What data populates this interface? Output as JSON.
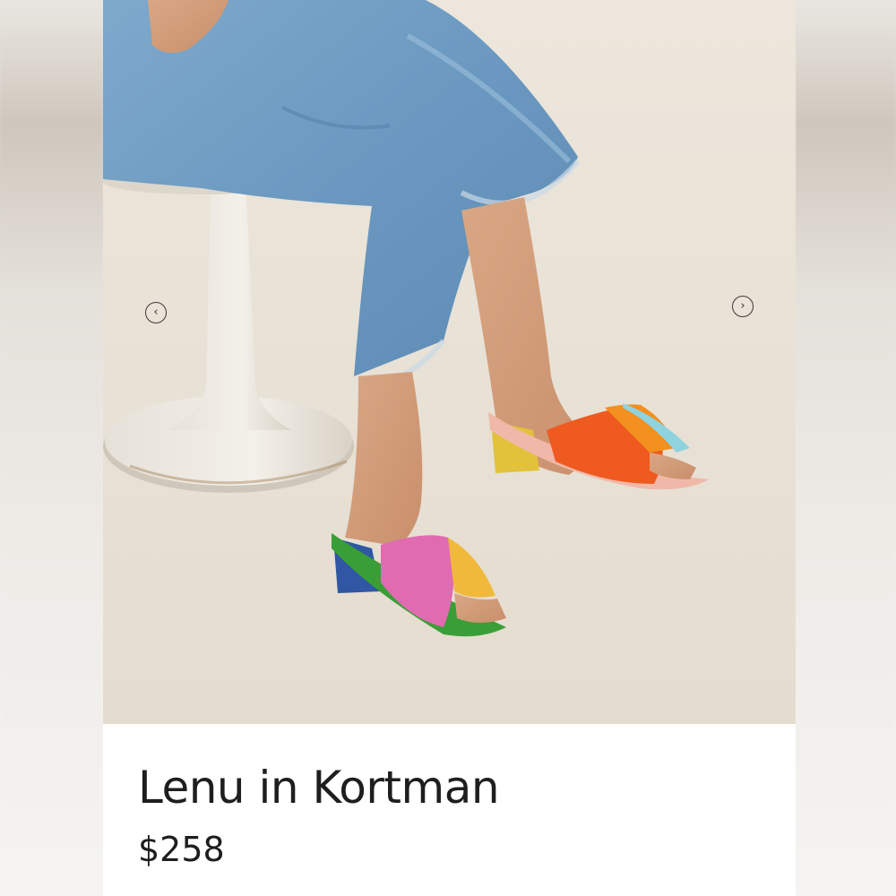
{
  "product": {
    "title": "Lenu in Kortman",
    "price": "$258"
  },
  "carousel": {
    "prev_icon": "chevron-left-icon",
    "next_icon": "chevron-right-icon",
    "prev_glyph": "‹",
    "next_glyph": "›"
  },
  "colors": {
    "title_text": "#1e1e1e",
    "photo_background": "#e7e1d6",
    "denim": "#6f9ec4"
  }
}
